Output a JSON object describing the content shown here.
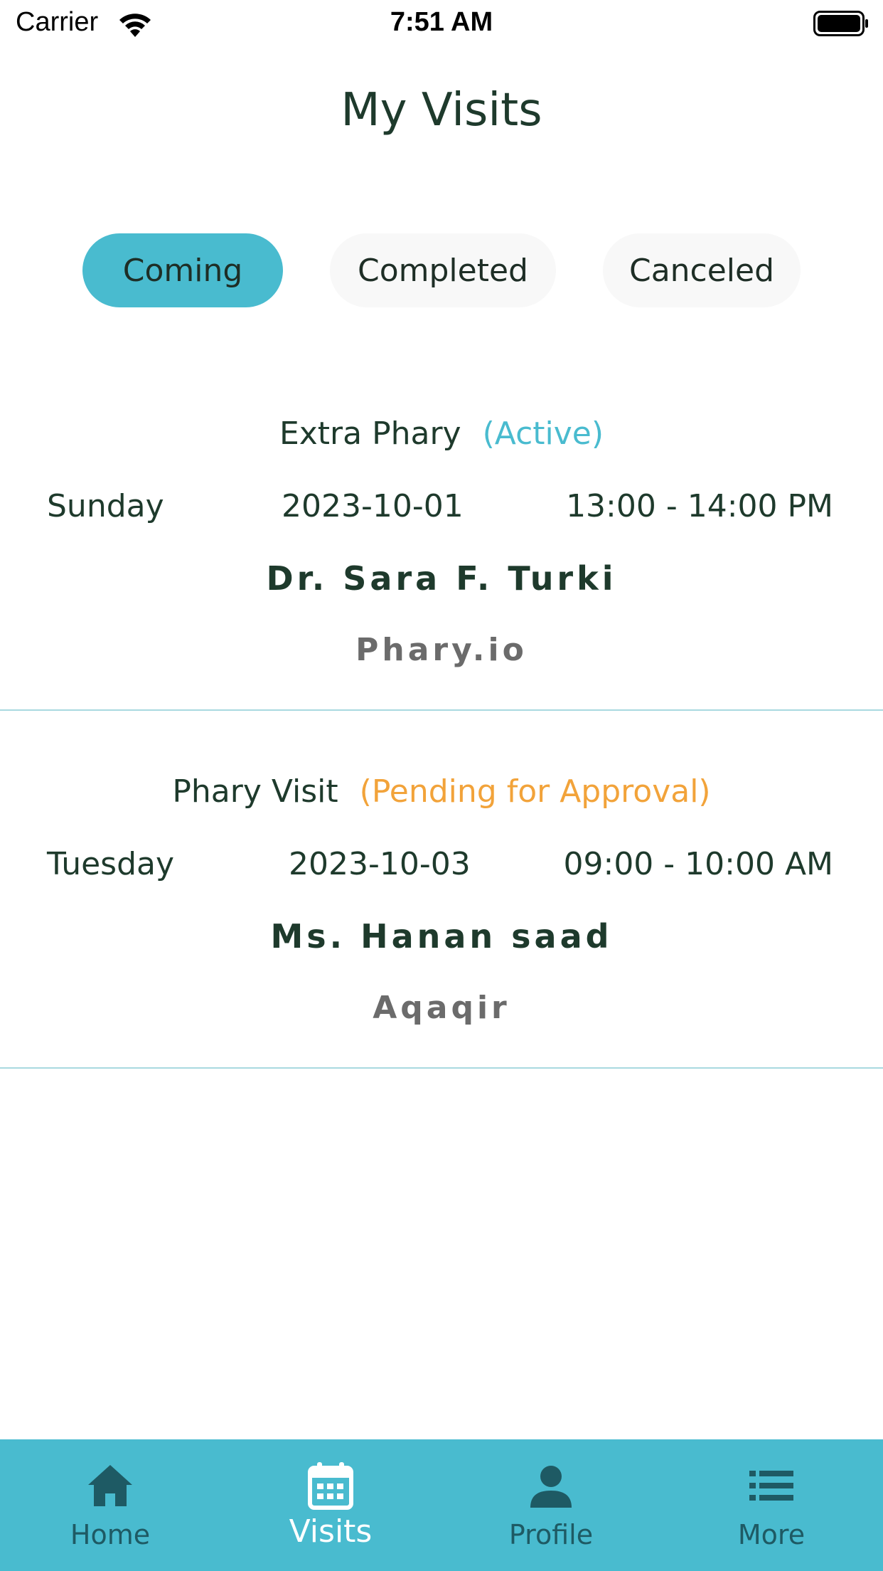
{
  "status_bar": {
    "carrier": "Carrier",
    "time": "7:51 AM"
  },
  "page": {
    "title": "My Visits"
  },
  "tabs": [
    {
      "label": "Coming",
      "active": true
    },
    {
      "label": "Completed",
      "active": false
    },
    {
      "label": "Canceled",
      "active": false
    }
  ],
  "visits": [
    {
      "title": "Extra Phary",
      "status": "(Active)",
      "day": "Sunday",
      "date": "2023-10-01",
      "time": "13:00 - 14:00 PM",
      "doctor": "Dr. Sara F. Turki",
      "organization": "Phary.io"
    },
    {
      "title": "Phary Visit",
      "status": "(Pending for Approval)",
      "day": "Tuesday",
      "date": "2023-10-03",
      "time": "09:00 - 10:00 AM",
      "doctor": "Ms. Hanan saad",
      "organization": "Aqaqir"
    }
  ],
  "nav": {
    "items": [
      {
        "label": "Home",
        "icon": "home-icon"
      },
      {
        "label": "Visits",
        "icon": "calendar-icon",
        "active": true
      },
      {
        "label": "Profile",
        "icon": "person-icon"
      },
      {
        "label": "More",
        "icon": "list-icon"
      }
    ]
  },
  "colors": {
    "accent": "#49bbcf",
    "pending": "#f2a33a",
    "text": "#1e3a2c",
    "muted": "#6b6b6b",
    "nav_icon": "#1e5a64"
  }
}
